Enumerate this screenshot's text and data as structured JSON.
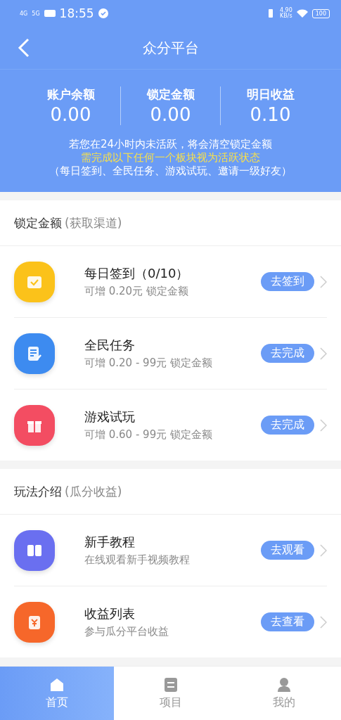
{
  "status_bar": {
    "network_1": "4G",
    "network_2": "5G",
    "time": "18:55",
    "speed": "4.90",
    "speed_unit": "KB/s",
    "battery": "100"
  },
  "header": {
    "title": "众分平台"
  },
  "summary": {
    "stats": [
      {
        "label": "账户余额",
        "value": "0.00"
      },
      {
        "label": "锁定金额",
        "value": "0.00"
      },
      {
        "label": "明日收益",
        "value": "0.10"
      }
    ],
    "notice": "若您在24小时内未活跃，将会清空锁定金额",
    "highlight": "需完成以下任何一个板块视为活跃状态",
    "note": "（每日签到、全民任务、游戏试玩、邀请一级好友）"
  },
  "sections": [
    {
      "title": "锁定金额",
      "subtitle": "(获取渠道)",
      "items": [
        {
          "kind": "calendar",
          "color": "#fbc21a",
          "title": "每日签到（0/10）",
          "desc": "可增 0.20元 锁定金额",
          "action": "去签到"
        },
        {
          "kind": "task",
          "color": "#3d8bf0",
          "title": "全民任务",
          "desc": "可增 0.20 - 99元 锁定金额",
          "action": "去完成"
        },
        {
          "kind": "gift",
          "color": "#f34d62",
          "title": "游戏试玩",
          "desc": "可增 0.60 - 99元 锁定金额",
          "action": "去完成"
        }
      ]
    },
    {
      "title": "玩法介绍",
      "subtitle": "(瓜分收益)",
      "items": [
        {
          "kind": "book",
          "color": "#6a6ff0",
          "title": "新手教程",
          "desc": "在线观看新手视频教程",
          "action": "去观看"
        },
        {
          "kind": "money",
          "color": "#f6672a",
          "title": "收益列表",
          "desc": "参与瓜分平台收益",
          "action": "去查看"
        }
      ]
    }
  ],
  "tab_bar": [
    {
      "kind": "home",
      "label": "首页",
      "selected": true
    },
    {
      "kind": "list",
      "label": "项目",
      "selected": false
    },
    {
      "kind": "user",
      "label": "我的",
      "selected": false
    }
  ]
}
